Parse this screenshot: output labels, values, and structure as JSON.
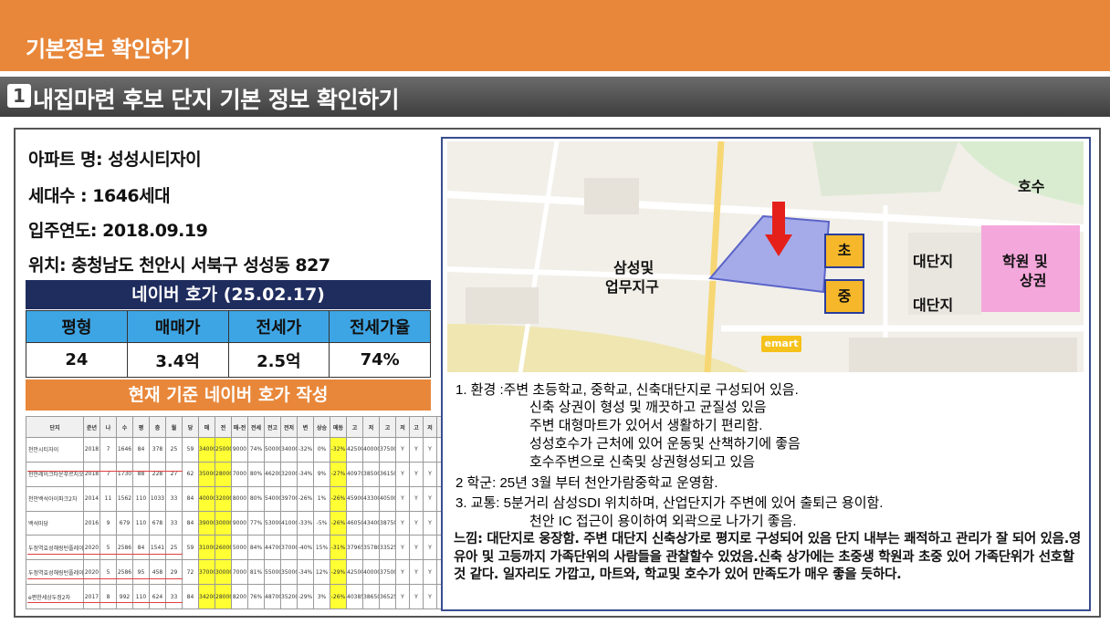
{
  "header": {
    "title": "기본정보 확인하기"
  },
  "section": {
    "number": "1",
    "title": "내집마련 후보 단지 기본 정보 확인하기"
  },
  "info": {
    "apt_name": "아파트 명: 성성시티자이",
    "households": "세대수 : 1646세대",
    "move_in": "입주연도:  2018.09.19",
    "location": "위치: 충청남도 천안시 서북구 성성동 827"
  },
  "naver": {
    "title": "네이버 호가 (25.02.17)",
    "headers": [
      "평형",
      "매매가",
      "전세가",
      "전세가율"
    ],
    "values": [
      "24",
      "3.4억",
      "2.5억",
      "74%"
    ],
    "write_label": "현재 기준 네이버 호가 작성"
  },
  "spreadsheet": {
    "headers": [
      "단지",
      "준년",
      "나",
      "수",
      "평",
      "층",
      "월",
      "당",
      "매",
      "전",
      "매-전",
      "전세",
      "전고",
      "전저",
      "변",
      "상승",
      "매등",
      "고",
      "저",
      "고",
      "저",
      "고",
      "저",
      "고"
    ],
    "rows": [
      [
        "천안시티자이",
        "2018",
        "7",
        "1646",
        "84",
        "378",
        "25",
        "59",
        "34000",
        "25000",
        "9000",
        "74%",
        "50000",
        "34000",
        "-32%",
        "0%",
        "-32%",
        "42500",
        "40000",
        "37500",
        "Y",
        "Y",
        "Y",
        "Y"
      ],
      [
        "천안레이크타운푸르지오",
        "2018",
        "7",
        "1730",
        "88",
        "228",
        "27",
        "62",
        "35000",
        "28000",
        "7000",
        "80%",
        "46200",
        "32000",
        "-34%",
        "9%",
        "-27%",
        "40970",
        "38500",
        "36150",
        "Y",
        "Y",
        "Y",
        "Y"
      ],
      [
        "천안백석아이파크2차",
        "2014",
        "11",
        "1562",
        "110",
        "1033",
        "33",
        "84",
        "40000",
        "32000",
        "8000",
        "80%",
        "54000",
        "39700",
        "-26%",
        "1%",
        "-26%",
        "45900",
        "43300",
        "40500",
        "Y",
        "Y",
        "Y",
        "Y"
      ],
      [
        "백석마당",
        "2016",
        "9",
        "679",
        "110",
        "678",
        "33",
        "84",
        "39000",
        "30000",
        "9000",
        "77%",
        "53000",
        "41000",
        "-33%",
        "-5%",
        "-26%",
        "46050",
        "43400",
        "38750",
        "Y",
        "Y",
        "Y",
        "Y"
      ],
      [
        "두정역효성해링턴플레이스",
        "2020",
        "5",
        "2586",
        "84",
        "1541",
        "25",
        "59",
        "31000",
        "26000",
        "5000",
        "84%",
        "44700",
        "37000",
        "-40%",
        "15%",
        "-31%",
        "37965",
        "35780",
        "33525",
        "Y",
        "Y",
        "Y",
        "Y"
      ],
      [
        "두정역효성해링턴플레이스",
        "2020",
        "5",
        "2586",
        "95",
        "458",
        "29",
        "72",
        "37000",
        "30000",
        "7000",
        "81%",
        "55000",
        "35000",
        "-34%",
        "12%",
        "-29%",
        "42500",
        "40000",
        "37500",
        "Y",
        "Y",
        "Y",
        "Y"
      ],
      [
        "e편한세상두정2차",
        "2017",
        "8",
        "992",
        "110",
        "624",
        "33",
        "84",
        "34200",
        "28000",
        "8200",
        "76%",
        "48700",
        "35200",
        "-29%",
        "3%",
        "-26%",
        "40385",
        "38650",
        "36525",
        "Y",
        "Y",
        "Y",
        "Y"
      ]
    ]
  },
  "map": {
    "labels": {
      "lake": "호수",
      "samsung_1": "삼성및",
      "samsung_2": "업무지구",
      "complex_1": "대단지",
      "complex_2": "대단지",
      "academy_1": "학원 및",
      "academy_2": "상권",
      "elementary": "초",
      "middle": "중",
      "emart": "emart"
    },
    "colors": {
      "target": "#8a94e8",
      "academy": "#f59ad8",
      "badge": "#f6b72a",
      "arrow": "#e5201b"
    }
  },
  "notes": {
    "line1": "1.   환경 :주변 초등학교, 중학교, 신축대단지로 구성되어 있음.",
    "line2": "신축 상권이 형성 및 깨끗하고 균질성 있음",
    "line3": "주변 대형마트가 있어서 생활하기 편리함.",
    "line4": "성성호수가 근처에 있어 운동및 산책하기에 좋음",
    "line5": "호수주변으로 신축및 상권형성되고 있음",
    "line6": "2     학군: 25년 3월 부터 천안가람중학교 운영함.",
    "line7": "3.   교통: 5분거리 삼성SDI 위치하며, 산업단지가 주변에 있어 출퇴근 용이함.",
    "line8": "천안 IC 접근이 용이하여 외곽으로 나가기 좋음.",
    "conclusion": "느낌: 대단지로 웅장함. 주변 대단지 신축상가로 평지로 구성되어 있음 단지 내부는 쾌적하고 관리가 잘 되어 있음.영유아 및 고등까지 가족단위의 사람들을 관찰할수 있었음.신축 상가에는 초중생 학원과 초중 있어 가족단위가 선호할 것 같다. 일자리도 가깝고, 마트와, 학교및 호수가 있어 만족도가 매우 좋을 듯하다."
  }
}
